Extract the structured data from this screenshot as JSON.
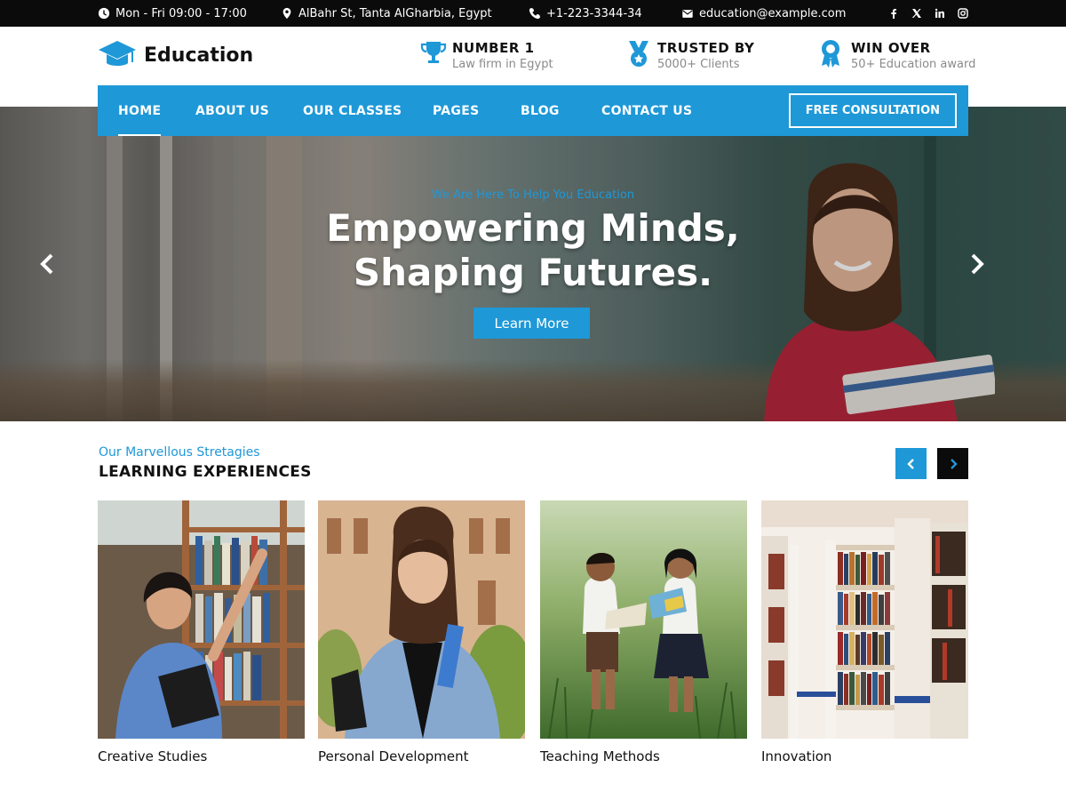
{
  "topbar": {
    "hours": "Mon - Fri 09:00 - 17:00",
    "address": "AlBahr St, Tanta AlGharbia, Egypt",
    "phone": "+1-223-3344-34",
    "email": "education@example.com",
    "socials": [
      "facebook-icon",
      "x-icon",
      "linkedin-icon",
      "instagram-icon"
    ]
  },
  "header": {
    "logo_text": "Education",
    "info": [
      {
        "icon": "trophy-icon",
        "title": "NUMBER 1",
        "sub": "Law firm in Egypt"
      },
      {
        "icon": "medal-icon",
        "title": "TRUSTED BY",
        "sub": "5000+ Clients"
      },
      {
        "icon": "award-icon",
        "title": "WIN OVER",
        "sub": "50+ Education award"
      }
    ]
  },
  "nav": {
    "items": [
      "HOME",
      "ABOUT US",
      "OUR CLASSES",
      "PAGES",
      "BLOG",
      "CONTACT US"
    ],
    "active": "HOME",
    "cta": "FREE CONSULTATION"
  },
  "hero": {
    "kicker": "We Are Here To Help You Education",
    "title_line1": "Empowering Minds,",
    "title_line2": "Shaping Futures.",
    "button": "Learn More"
  },
  "section": {
    "kicker": "Our Marvellous Stretagies",
    "title": "LEARNING EXPERIENCES",
    "cards": [
      {
        "caption": "Creative Studies"
      },
      {
        "caption": "Personal Development"
      },
      {
        "caption": "Teaching Methods"
      },
      {
        "caption": "Innovation"
      }
    ]
  },
  "colors": {
    "accent": "#1e98d7",
    "topbar_bg": "#0b0b0b"
  }
}
